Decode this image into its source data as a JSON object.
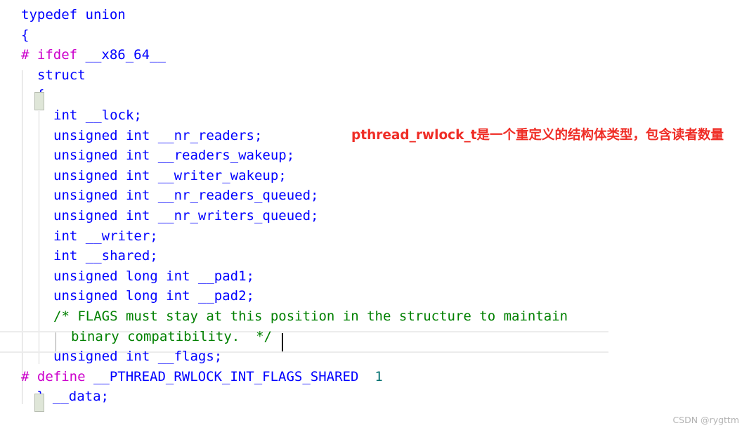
{
  "editor": {
    "language": "c",
    "font_size_px": 19,
    "line_height_px": 28.6,
    "background_color": "#ffffff",
    "caret": {
      "line_index": 13,
      "column_after": "*/",
      "color": "#000000"
    },
    "current_line_index": 13,
    "colors": {
      "keyword": "#0000ff",
      "identifier": "#0000ff",
      "preprocessor": "#cc00cc",
      "comment": "#008000",
      "number": "#007070",
      "bracket_match_bg": "#dfe6d8",
      "bracket_match_border": "#b7bdb1",
      "indent_guide": "#d4d4d4",
      "indent_guide_active": "#a0a0a0",
      "current_line_rule": "#ececec",
      "annotation": "#ef2d26",
      "watermark": "#b3b3b3"
    },
    "lines": [
      {
        "indent": 0,
        "tokens": [
          {
            "t": "typedef union",
            "c": "kw"
          }
        ]
      },
      {
        "indent": 0,
        "tokens": [
          {
            "t": "{",
            "c": "punct"
          }
        ]
      },
      {
        "indent": 0,
        "tokens": [
          {
            "t": "# ifdef ",
            "c": "pp"
          },
          {
            "t": "__x86_64__",
            "c": "ident"
          }
        ]
      },
      {
        "indent": 1,
        "tokens": [
          {
            "t": "struct",
            "c": "kw"
          }
        ]
      },
      {
        "indent": 1,
        "tokens": [
          {
            "t": "{",
            "c": "punct"
          }
        ]
      },
      {
        "indent": 2,
        "tokens": [
          {
            "t": "int __lock;",
            "c": "kw"
          }
        ]
      },
      {
        "indent": 2,
        "tokens": [
          {
            "t": "unsigned int __nr_readers;",
            "c": "kw"
          }
        ]
      },
      {
        "indent": 2,
        "tokens": [
          {
            "t": "unsigned int __readers_wakeup;",
            "c": "kw"
          }
        ]
      },
      {
        "indent": 2,
        "tokens": [
          {
            "t": "unsigned int __writer_wakeup;",
            "c": "kw"
          }
        ]
      },
      {
        "indent": 2,
        "tokens": [
          {
            "t": "unsigned int __nr_readers_queued;",
            "c": "kw"
          }
        ]
      },
      {
        "indent": 2,
        "tokens": [
          {
            "t": "unsigned int __nr_writers_queued;",
            "c": "kw"
          }
        ]
      },
      {
        "indent": 2,
        "tokens": [
          {
            "t": "int __writer;",
            "c": "kw"
          }
        ]
      },
      {
        "indent": 2,
        "tokens": [
          {
            "t": "int __shared;",
            "c": "kw"
          }
        ]
      },
      {
        "indent": 2,
        "tokens": [
          {
            "t": "unsigned long int __pad1;",
            "c": "kw"
          }
        ]
      },
      {
        "indent": 2,
        "tokens": [
          {
            "t": "unsigned long int __pad2;",
            "c": "kw"
          }
        ]
      },
      {
        "indent": 2,
        "tokens": [
          {
            "t": "/* FLAGS must stay at this position in the structure to maintain",
            "c": "cmt"
          }
        ]
      },
      {
        "indent": 3,
        "tokens": [
          {
            "t": "binary compatibility.  */",
            "c": "cmt"
          }
        ]
      },
      {
        "indent": 2,
        "tokens": [
          {
            "t": "unsigned int __flags;",
            "c": "kw"
          }
        ]
      },
      {
        "indent": 0,
        "tokens": [
          {
            "t": "# define ",
            "c": "pp"
          },
          {
            "t": "__PTHREAD_RWLOCK_INT_FLAGS_SHARED",
            "c": "ident"
          },
          {
            "t": "  ",
            "c": "kw"
          },
          {
            "t": "1",
            "c": "num"
          }
        ]
      },
      {
        "indent": 1,
        "tokens": [
          {
            "t": "} __data;",
            "c": "punct"
          }
        ]
      }
    ]
  },
  "annotation": {
    "text": "pthread_rwlock_t是一个重定义的结构体类型，包含读者数量"
  },
  "watermark": {
    "text": "CSDN @rygttm"
  }
}
